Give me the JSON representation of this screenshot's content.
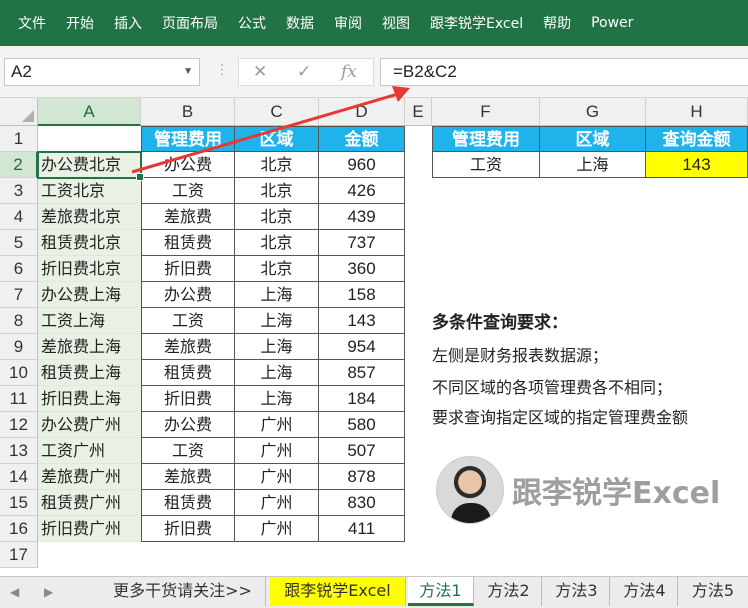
{
  "ribbon": {
    "tabs": [
      "文件",
      "开始",
      "插入",
      "页面布局",
      "公式",
      "数据",
      "审阅",
      "视图",
      "跟李锐学Excel",
      "帮助",
      "Power"
    ]
  },
  "formula_bar": {
    "name_box": "A2",
    "cancel_icon": "✕",
    "enter_icon": "✓",
    "fx_icon": "fx",
    "formula": "=B2&C2"
  },
  "grid": {
    "columns": [
      "A",
      "B",
      "C",
      "D",
      "E",
      "F",
      "G",
      "H"
    ],
    "rows": [
      "1",
      "2",
      "3",
      "4",
      "5",
      "6",
      "7",
      "8",
      "9",
      "10",
      "11",
      "12",
      "13",
      "14",
      "15",
      "16",
      "17"
    ],
    "table_headers": [
      "管理费用",
      "区域",
      "金额"
    ],
    "col_a": [
      "办公费北京",
      "工资北京",
      "差旅费北京",
      "租赁费北京",
      "折旧费北京",
      "办公费上海",
      "工资上海",
      "差旅费上海",
      "租赁费上海",
      "折旧费上海",
      "办公费广州",
      "工资广州",
      "差旅费广州",
      "租赁费广州",
      "折旧费广州"
    ],
    "col_b": [
      "办公费",
      "工资",
      "差旅费",
      "租赁费",
      "折旧费",
      "办公费",
      "工资",
      "差旅费",
      "租赁费",
      "折旧费",
      "办公费",
      "工资",
      "差旅费",
      "租赁费",
      "折旧费"
    ],
    "col_c": [
      "北京",
      "北京",
      "北京",
      "北京",
      "北京",
      "上海",
      "上海",
      "上海",
      "上海",
      "上海",
      "广州",
      "广州",
      "广州",
      "广州",
      "广州"
    ],
    "col_d": [
      "960",
      "426",
      "439",
      "737",
      "360",
      "158",
      "143",
      "954",
      "857",
      "184",
      "580",
      "507",
      "878",
      "830",
      "411"
    ]
  },
  "query": {
    "headers": [
      "管理费用",
      "区域",
      "查询金额"
    ],
    "values": [
      "工资",
      "上海",
      "143"
    ]
  },
  "notes": {
    "title": "多条件查询要求：",
    "lines": [
      "左侧是财务报表数据源；",
      "不同区域的各项管理费各不相同；",
      "要求查询指定区域的指定管理费金额"
    ]
  },
  "brand": {
    "text": "跟李锐学Excel"
  },
  "sheet_tabs": {
    "nav_prev": "◀",
    "nav_next": "▶",
    "tabs": [
      "更多干货请关注>>",
      "跟李锐学Excel",
      "方法1",
      "方法2",
      "方法3",
      "方法4",
      "方法5"
    ]
  },
  "colors": {
    "ribbon": "#217346",
    "header_blue": "#1fb3ec",
    "highlight": "#ffff00",
    "col_a_fill": "#e8f1e4",
    "arrow": "#e53935"
  }
}
